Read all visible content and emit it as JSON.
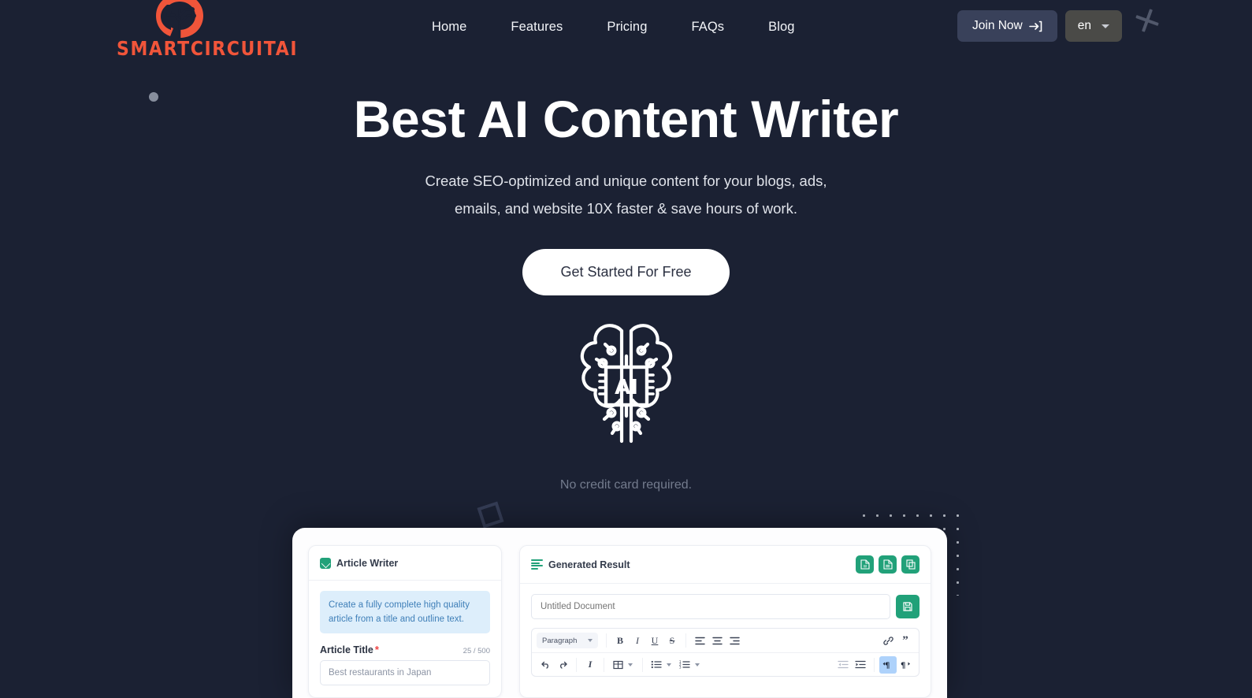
{
  "theme": {
    "background": "#1b2133",
    "brand_orange": "#f1553a",
    "accent_green": "#21a179",
    "info_blue": "#ddeefb",
    "text_white": "#ffffff",
    "muted": "#737b8d"
  },
  "header": {
    "logo_text": "SMARTCIRCUITAI",
    "logo_icon": "circuit-brain-head-icon",
    "nav": [
      {
        "label": "Home"
      },
      {
        "label": "Features"
      },
      {
        "label": "Pricing"
      },
      {
        "label": "FAQs"
      },
      {
        "label": "Blog"
      }
    ],
    "join_label": "Join Now",
    "join_icon": "arrow-into-bracket-icon",
    "language": "en",
    "language_caret_icon": "chevron-down-icon"
  },
  "hero": {
    "title": "Best AI Content Writer",
    "subtitle_line1": "Create SEO-optimized and unique content for your blogs, ads,",
    "subtitle_line2": "emails, and website 10X faster & save hours of work.",
    "cta_label": "Get Started For Free",
    "brain_icon": "ai-brain-chip-icon",
    "brain_chip_label": "AI",
    "note": "No credit card required."
  },
  "preview": {
    "article_writer": {
      "title": "Article Writer",
      "title_icon": "pencil-square-icon",
      "info_text": "Create a fully complete high quality article from a title and outline text.",
      "field_label": "Article Title",
      "required_mark": "*",
      "counter": "25 / 500",
      "input_value": "Best restaurants in Japan"
    },
    "generated_result": {
      "title": "Generated Result",
      "title_icon": "text-lines-icon",
      "actions": [
        {
          "name": "export-word-button",
          "icon": "word-file-icon"
        },
        {
          "name": "export-file-button",
          "icon": "document-file-icon"
        },
        {
          "name": "copy-button",
          "icon": "copy-icon"
        }
      ],
      "doc_placeholder": "Untitled Document",
      "save_icon": "save-disk-icon",
      "toolbar_row1": [
        {
          "name": "block-format-select",
          "label": "Paragraph",
          "icon": "chevron-down-icon",
          "type": "select"
        },
        {
          "name": "bold-button",
          "label": "B",
          "icon": "bold-icon"
        },
        {
          "name": "italic-button",
          "label": "I",
          "icon": "italic-icon"
        },
        {
          "name": "underline-button",
          "label": "U",
          "icon": "underline-icon"
        },
        {
          "name": "strikethrough-button",
          "label": "S",
          "icon": "strikethrough-icon"
        },
        {
          "name": "align-left-button",
          "label": "",
          "icon": "align-left-icon"
        },
        {
          "name": "align-center-button",
          "label": "",
          "icon": "align-center-icon"
        },
        {
          "name": "align-right-button",
          "label": "",
          "icon": "align-right-icon"
        },
        {
          "name": "link-button",
          "label": "",
          "icon": "link-icon"
        },
        {
          "name": "blockquote-button",
          "label": "”",
          "icon": "quote-icon"
        }
      ],
      "toolbar_row2": [
        {
          "name": "undo-button",
          "label": "",
          "icon": "undo-icon"
        },
        {
          "name": "redo-button",
          "label": "",
          "icon": "redo-icon"
        },
        {
          "name": "clear-format-button",
          "label": "",
          "icon": "clear-format-icon"
        },
        {
          "name": "table-button",
          "label": "",
          "icon": "table-icon"
        },
        {
          "name": "bullet-list-button",
          "label": "",
          "icon": "bullet-list-icon"
        },
        {
          "name": "numbered-list-button",
          "label": "",
          "icon": "numbered-list-icon"
        },
        {
          "name": "outdent-button",
          "label": "",
          "icon": "outdent-icon"
        },
        {
          "name": "indent-button",
          "label": "",
          "icon": "indent-icon"
        },
        {
          "name": "rtl-button",
          "label": "",
          "icon": "paragraph-rtl-icon",
          "active": true
        },
        {
          "name": "ltr-button",
          "label": "",
          "icon": "paragraph-ltr-icon"
        }
      ]
    }
  }
}
